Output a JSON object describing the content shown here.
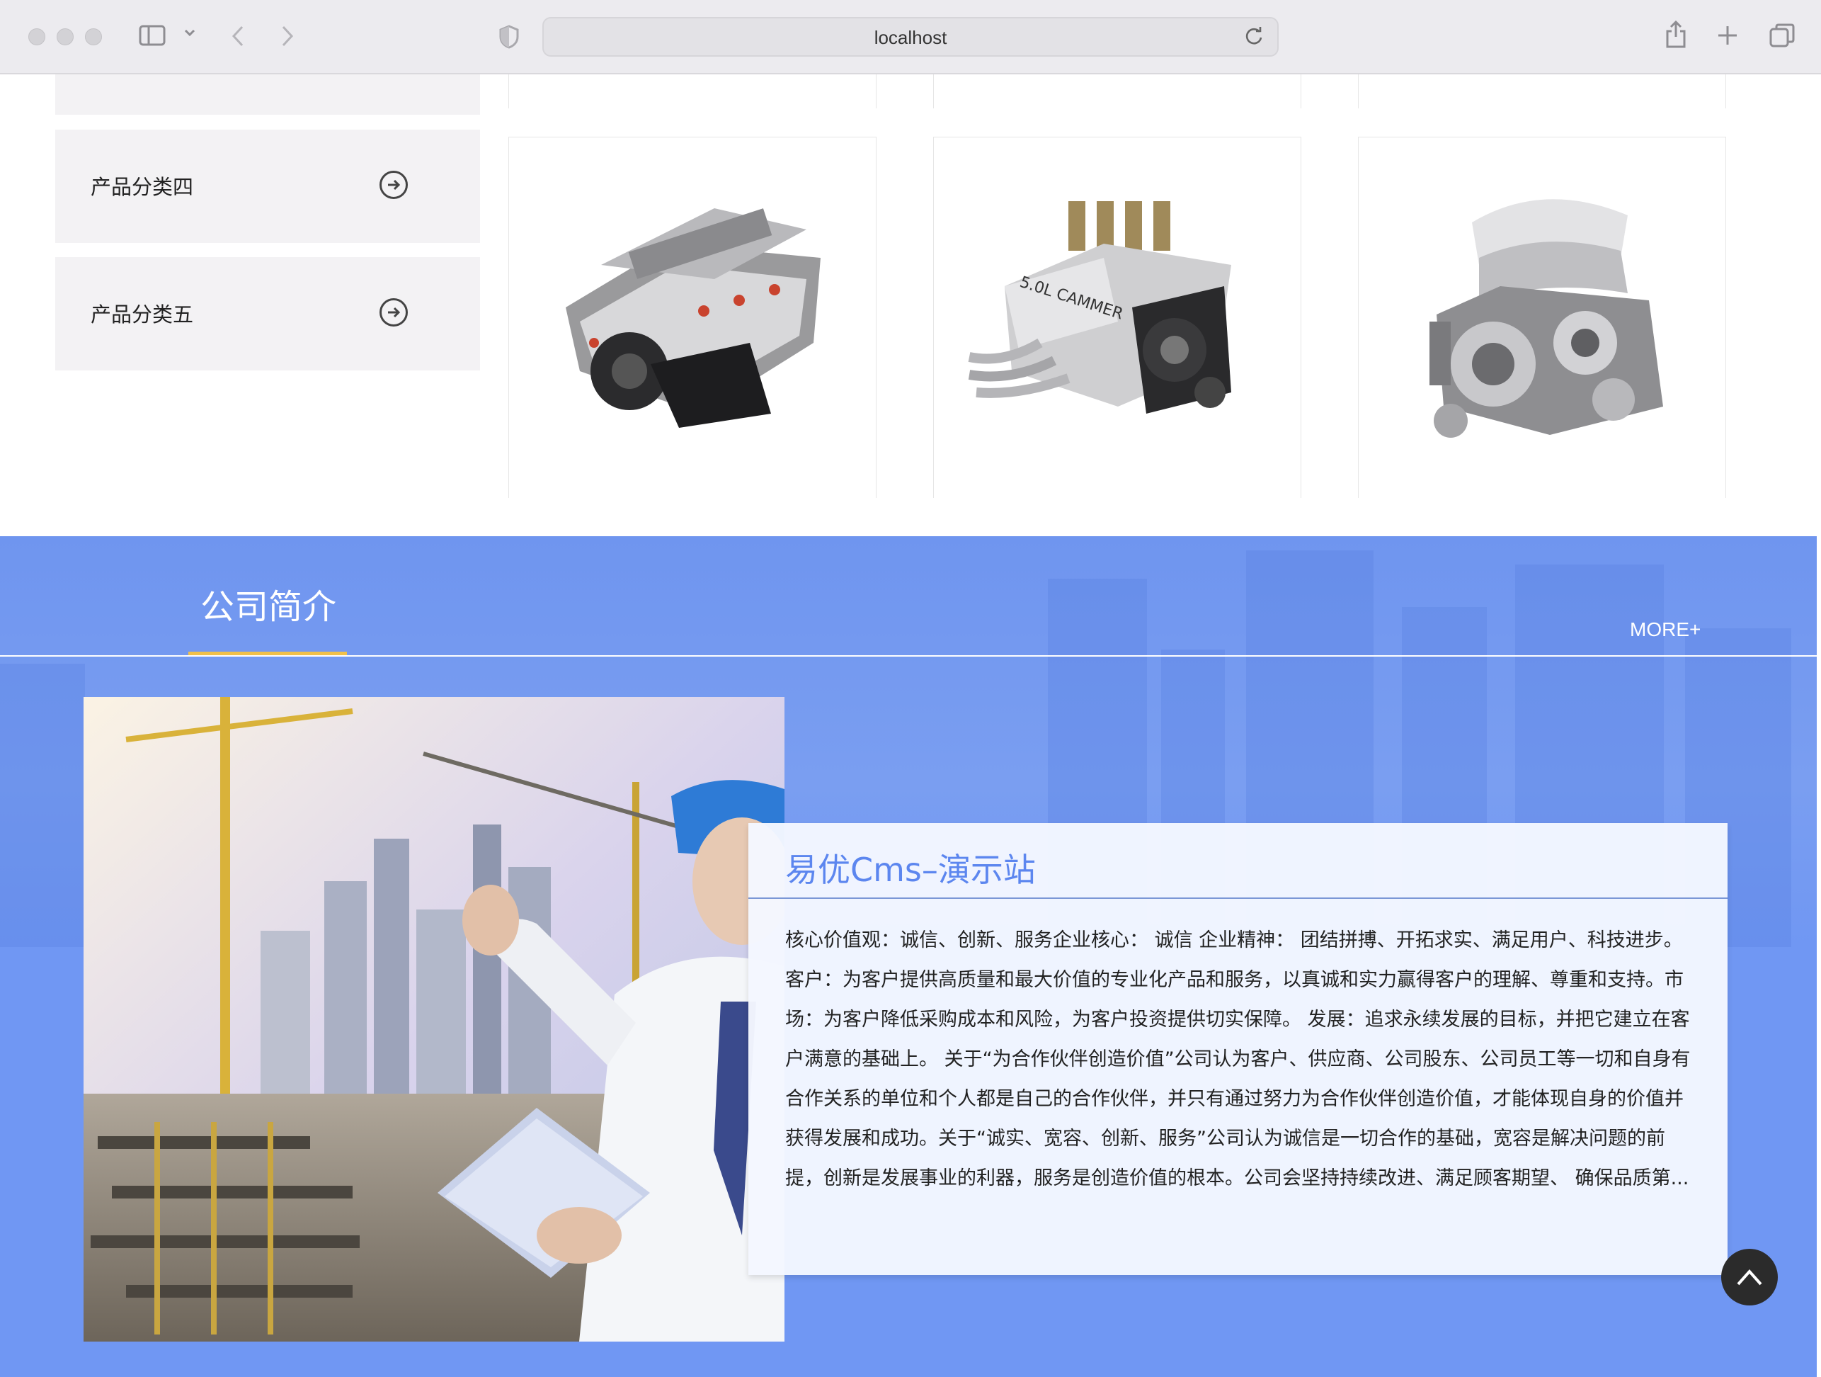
{
  "browser": {
    "url": "localhost"
  },
  "icons": {
    "sidebar": "sidebar-icon",
    "back": "back-arrow-icon",
    "forward": "forward-arrow-icon",
    "shield": "shield-icon",
    "reload": "reload-icon",
    "share": "share-icon",
    "new_tab": "plus-icon",
    "tabs": "tabs-overview-icon",
    "category_arrow": "circle-arrow-right-icon",
    "back_to_top": "chevron-up-icon"
  },
  "categories": [
    {
      "label": "产品分类四"
    },
    {
      "label": "产品分类五"
    }
  ],
  "products": [
    {
      "image": "engine-v8-image"
    },
    {
      "image": "engine-cammer-image"
    },
    {
      "image": "engine-chrome-image"
    }
  ],
  "about": {
    "title": "公司简介",
    "more": "MORE+",
    "company_name": "易优Cms–演示站",
    "description": "核心价值观：诚信、创新、服务企业核心： 诚信 企业精神： 团结拼搏、开拓求实、满足用户、科技进步。 客户：为客户提供高质量和最大价值的专业化产品和服务，以真诚和实力赢得客户的理解、尊重和支持。市场：为客户降低采购成本和风险，为客户投资提供切实保障。 发展：追求永续发展的目标，并把它建立在客户满意的基础上。 关于“为合作伙伴创造价值”公司认为客户、供应商、公司股东、公司员工等一切和自身有合作关系的单位和个人都是自己的合作伙伴，并只有通过努力为合作伙伴创造价值，才能体现自身的价值并获得发展和成功。关于“诚实、宽容、创新、服务”公司认为诚信是一切合作的基础，宽容是解决问题的前提，创新是发展事业的利器，服务是创造价值的根本。公司会坚持持续改进、满足顾客期望、 确保品质第..."
  },
  "colors": {
    "accent": "#7097f3",
    "title_blue": "#5c86ef",
    "underline": "#f0c04a"
  }
}
